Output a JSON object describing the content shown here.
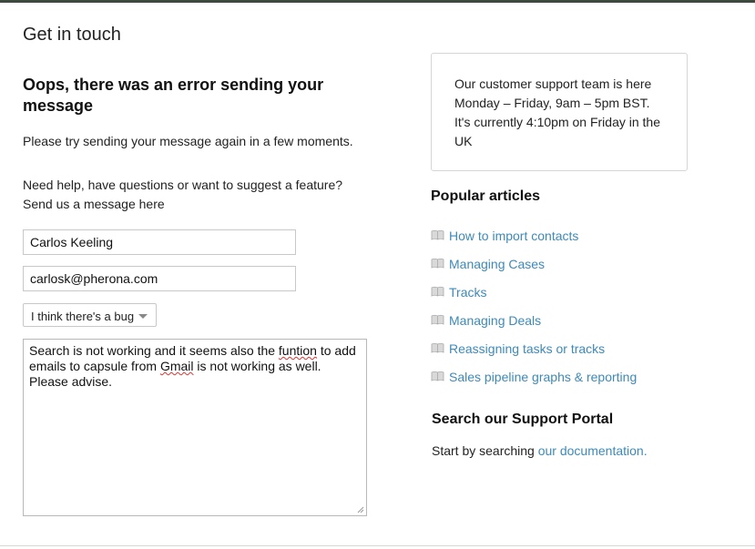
{
  "dialog": {
    "title": "Get in touch"
  },
  "error": {
    "heading": "Oops, there was an error sending your message",
    "subtext": "Please try sending your message again in a few moments."
  },
  "form": {
    "intro_line1": "Need help, have questions or want to suggest a feature?",
    "intro_line2": "Send us a message here",
    "name_value": "Carlos Keeling",
    "email_value": "carlosk@pherona.com",
    "topic_selected": "I think there's a bug",
    "message_part1": "Search is not working and it seems also the ",
    "message_misspelled1": "funtion",
    "message_part2": " to add emails to capsule from ",
    "message_misspelled2": "Gmail",
    "message_part3": " is not working as well. Please advise."
  },
  "support_hours": {
    "line1": "Our customer support team is here",
    "line2": "Monday – Friday, 9am – 5pm BST.",
    "line3": "It's currently 4:10pm on Friday in the UK"
  },
  "popular": {
    "heading": "Popular articles",
    "icon": "book-icon",
    "articles": [
      "How to import contacts",
      "Managing Cases",
      "Tracks",
      "Managing Deals",
      "Reassigning tasks or tracks",
      "Sales pipeline graphs & reporting"
    ]
  },
  "support_portal": {
    "heading": "Search our Support Portal",
    "text": "Start by searching ",
    "link": "our documentation."
  },
  "colors": {
    "link": "#3d8ab8",
    "border": "#c8c8c8",
    "topbar": "#3d4a3c"
  }
}
